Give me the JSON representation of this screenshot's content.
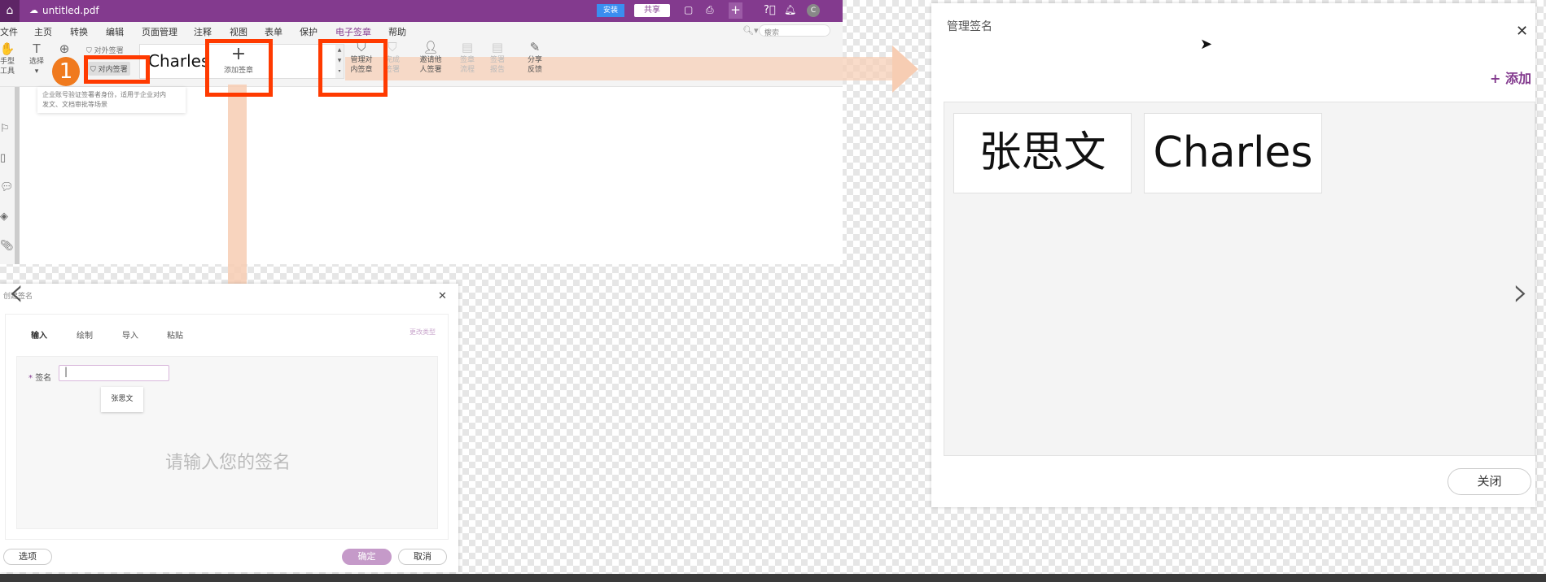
{
  "titlebar": {
    "file_name": "untitled.pdf",
    "install": "安装",
    "share": "共享",
    "avatar": "C"
  },
  "menu": [
    "文件",
    "主页",
    "转换",
    "编辑",
    "页面管理",
    "注释",
    "视图",
    "表单",
    "保护",
    "电子签章",
    "帮助"
  ],
  "search": {
    "placeholder": "搜索"
  },
  "toolbar": {
    "hand": [
      "手型",
      "工具"
    ],
    "select": "选择",
    "external_sign": "对外签署",
    "internal_sign": "对内签署",
    "gallery_sig": "Charles",
    "add_seal": "添加签章",
    "manage": [
      "管理对",
      "内签章"
    ],
    "finish": [
      "完成",
      "签署"
    ],
    "invite": [
      "邀请他",
      "人签署"
    ],
    "flow": [
      "签章",
      "流程"
    ],
    "report": [
      "签署",
      "报告"
    ],
    "feedback": [
      "分享",
      "反馈"
    ]
  },
  "tooltip": {
    "line1": "企业账号验证签署者身份，适用于企业对内",
    "line2": "发文、文档审批等场景"
  },
  "step_badge": "1",
  "create_dialog": {
    "title": "创建签名",
    "tabs": [
      "输入",
      "绘制",
      "导入",
      "粘贴"
    ],
    "change_type": "更改类型",
    "field_label": "签名",
    "suggestion": "张思文",
    "placeholder": "请输入您的签名",
    "options": "选项",
    "ok": "确定",
    "cancel": "取消"
  },
  "manage_dialog": {
    "title": "管理签名",
    "add": "+ 添加",
    "signatures": [
      "张思文",
      "Charles"
    ],
    "close": "关闭"
  },
  "colors": {
    "brand": "#833a8e",
    "highlight": "#ff3a00",
    "arrow": "#f7cdb3",
    "confirm": "#c59ac9"
  }
}
